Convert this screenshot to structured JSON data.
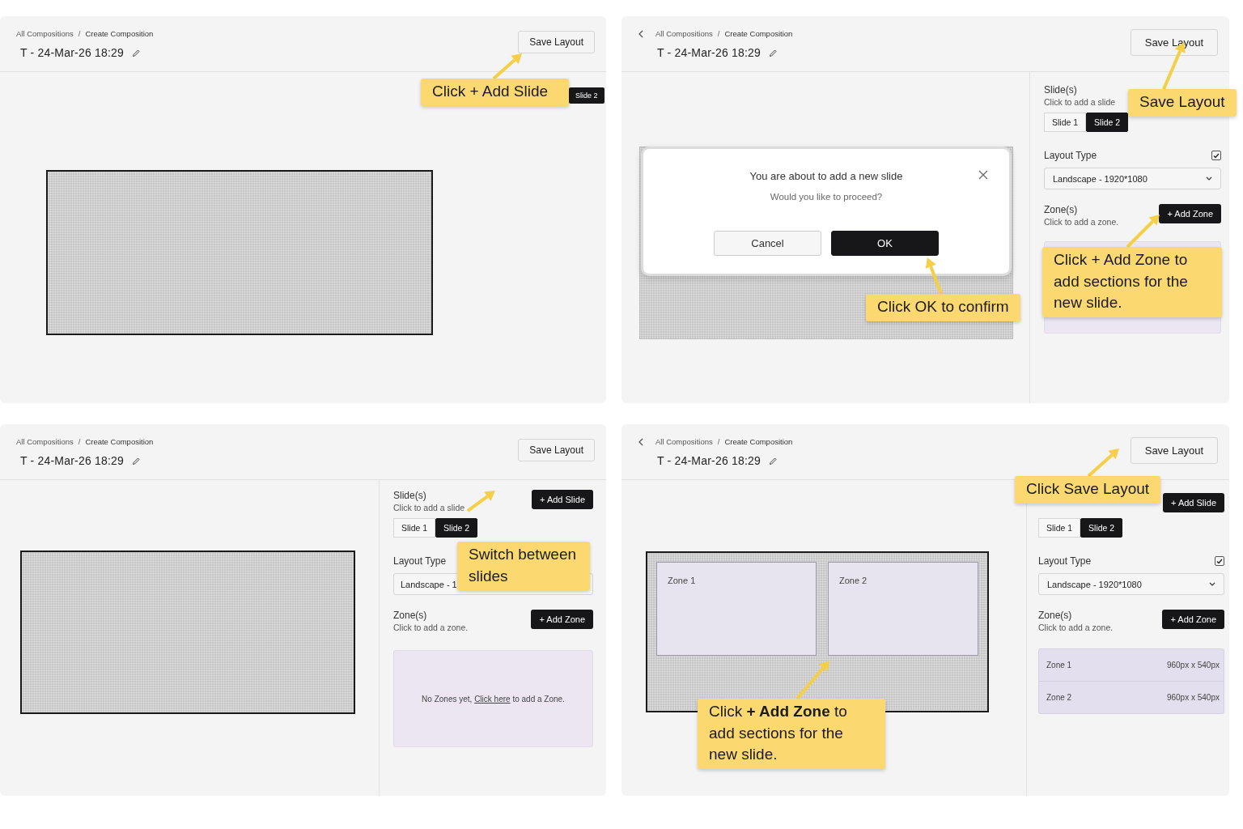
{
  "panels": [
    {
      "breadcrumb": [
        "All Compositions",
        "Create Composition"
      ],
      "separator": "/",
      "title": "T - 24-Mar-26 18:29",
      "save_button": "Save Layout",
      "peek_tab": {
        "label": "Slide 2",
        "selected": true
      },
      "callouts": [
        {
          "text": "Click + Add Slide"
        }
      ]
    },
    {
      "back": true,
      "breadcrumb": [
        "All Compositions",
        "Create Composition"
      ],
      "separator": "/",
      "title": "T - 24-Mar-26 18:29",
      "save_button": "Save Layout",
      "modal": {
        "title": "You are about to add a new slide",
        "message": "Would you like to proceed?",
        "cancel": "Cancel",
        "ok": "OK"
      },
      "sidebar": {
        "slides_title": "Slide(s)",
        "slides_hint": "Click to add a slide",
        "slide_tabs": [
          {
            "label": "Slide 1",
            "selected": false
          },
          {
            "label": "Slide 2",
            "selected": true
          }
        ],
        "layout_label": "Layout Type",
        "layout_checked": true,
        "layout_value": "Landscape - 1920*1080",
        "zones_title": "Zone(s)",
        "zones_hint": "Click to add a zone.",
        "add_zone": "+ Add Zone",
        "zone_area": {
          "kind": "empty"
        }
      },
      "callouts": [
        {
          "text": "Save Layout"
        },
        {
          "text": "Click OK to confirm"
        },
        {
          "text": "Click + Add Zone to add sections for the new slide."
        }
      ]
    },
    {
      "breadcrumb": [
        "All Compositions",
        "Create Composition"
      ],
      "separator": "/",
      "title": "T - 24-Mar-26 18:29",
      "save_button": "Save Layout",
      "sidebar": {
        "slides_title": "Slide(s)",
        "slides_hint": "Click to add a slide",
        "add_slide": "+ Add Slide",
        "slide_tabs": [
          {
            "label": "Slide 1",
            "selected": false
          },
          {
            "label": "Slide 2",
            "selected": true
          }
        ],
        "layout_label": "Layout Type",
        "layout_value": "Landscape - 1",
        "zones_title": "Zone(s)",
        "zones_hint": "Click to add a zone.",
        "add_zone": "+ Add Zone",
        "zone_area": {
          "kind": "empty",
          "message": "No Zones yet, ",
          "link": "Click here",
          "message_end": " to add a Zone."
        }
      },
      "callouts": [
        {
          "text": "Switch between slides"
        }
      ]
    },
    {
      "back": true,
      "breadcrumb": [
        "All Compositions",
        "Create Composition"
      ],
      "separator": "/",
      "title": "T - 24-Mar-26 18:29",
      "save_button": "Save Layout",
      "canvas": {
        "zones": [
          {
            "label": "Zone 1"
          },
          {
            "label": "Zone 2"
          }
        ]
      },
      "sidebar": {
        "add_slide": "+ Add Slide",
        "slide_tabs": [
          {
            "label": "Slide 1",
            "selected": false
          },
          {
            "label": "Slide 2",
            "selected": true
          }
        ],
        "layout_label": "Layout Type",
        "layout_checked": true,
        "layout_value": "Landscape - 1920*1080",
        "zones_title": "Zone(s)",
        "zones_hint": "Click to add a zone.",
        "add_zone": "+ Add Zone",
        "zone_area": {
          "kind": "list",
          "zones": [
            {
              "name": "Zone 1",
              "size": "960px x 540px"
            },
            {
              "name": "Zone 2",
              "size": "960px x 540px"
            }
          ]
        }
      },
      "callouts": [
        {
          "text": "Click Save Layout"
        },
        {
          "text": "Click **+ Add Zone** to add sections for the new slide."
        }
      ]
    }
  ]
}
